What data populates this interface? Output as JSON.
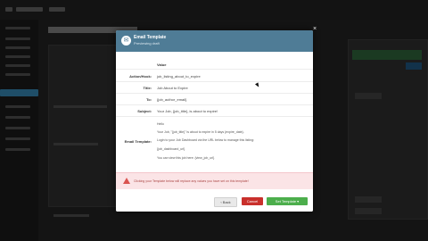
{
  "modal": {
    "title": "Email Template",
    "subtitle": "Previewing draft",
    "close_label": "×",
    "fields": {
      "header_value": "Value",
      "action_hook_label": "Action/Hook:",
      "action_hook_value": "job_listing_about_to_expire",
      "title_label": "Title:",
      "title_value": "Job About to Expire",
      "to_label": "To:",
      "to_value": "{job_author_email}",
      "subject_label": "Subject:",
      "subject_value": "Your Job, {job_title}, is about to expire!",
      "template_label": "Email Template:",
      "template_lines": [
        "Hello",
        "Your Job, \"{job_title}\" is about to expire in 5 days {expire_date}.",
        "Login to your Job Dashboard via the URL below to manage this listing:",
        "{job_dashboard_url}",
        "You can view this job here: {view_job_url}"
      ]
    },
    "alert_text": "Clicking your Template below will replace any values you have set on this template!",
    "buttons": {
      "back": "‹ Back",
      "cancel": "Cancel",
      "send": "Set Template ▾"
    }
  },
  "colors": {
    "header": "#4f7c96",
    "alert_bg": "#fbe4e6",
    "cancel": "#c9302c",
    "send": "#4cae4c"
  }
}
